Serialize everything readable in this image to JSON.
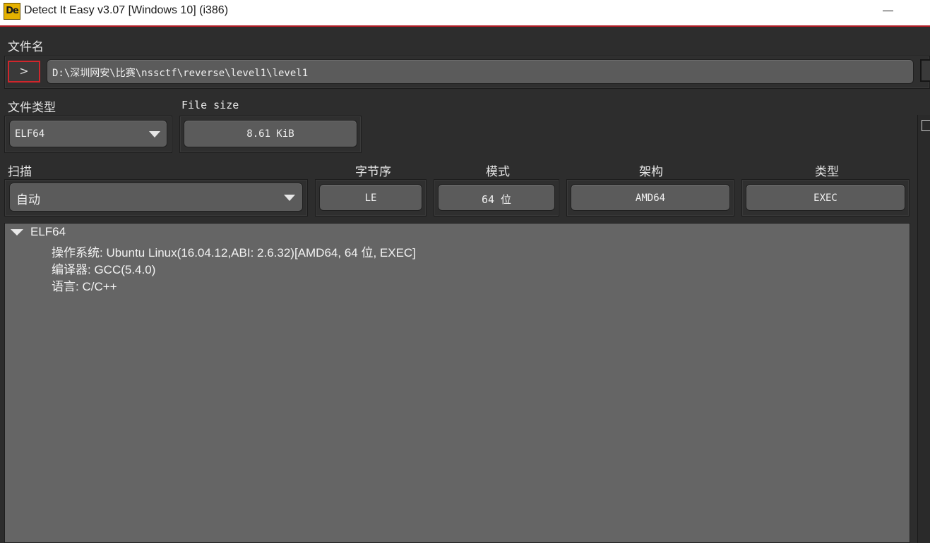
{
  "window": {
    "logo_text": "De",
    "title": "Detect It Easy v3.07 [Windows 10] (i386)"
  },
  "file": {
    "label": "文件名",
    "expand_symbol": ">",
    "path": "D:\\深圳网安\\比赛\\nssctf\\reverse\\level1\\level1"
  },
  "file_type": {
    "label": "文件类型",
    "value": "ELF64"
  },
  "file_size": {
    "label": "File size",
    "value": "8.61 KiB"
  },
  "scan": {
    "label": "扫描",
    "value": "自动"
  },
  "info": {
    "endianness_label": "字节序",
    "endianness_value": "LE",
    "mode_label": "模式",
    "mode_value": "64 位",
    "arch_label": "架构",
    "arch_value": "AMD64",
    "type_label": "类型",
    "type_value": "EXEC"
  },
  "results": {
    "root": "ELF64",
    "items": [
      "操作系统: Ubuntu Linux(16.04.12,ABI: 2.6.32)[AMD64, 64 位, EXEC]",
      "编译器: GCC(5.4.0)",
      "语言: C/C++"
    ]
  },
  "icons": {
    "minimize": "minimize-icon",
    "dropdown": "chevron-down-icon",
    "tree_expand": "tree-expanded-icon"
  },
  "colors": {
    "accent_border": "#d0262c",
    "title_underline": "#b11c24",
    "panel_bg": "#2d2d2d",
    "field_bg": "#5b5b5b",
    "results_bg": "#656565"
  }
}
